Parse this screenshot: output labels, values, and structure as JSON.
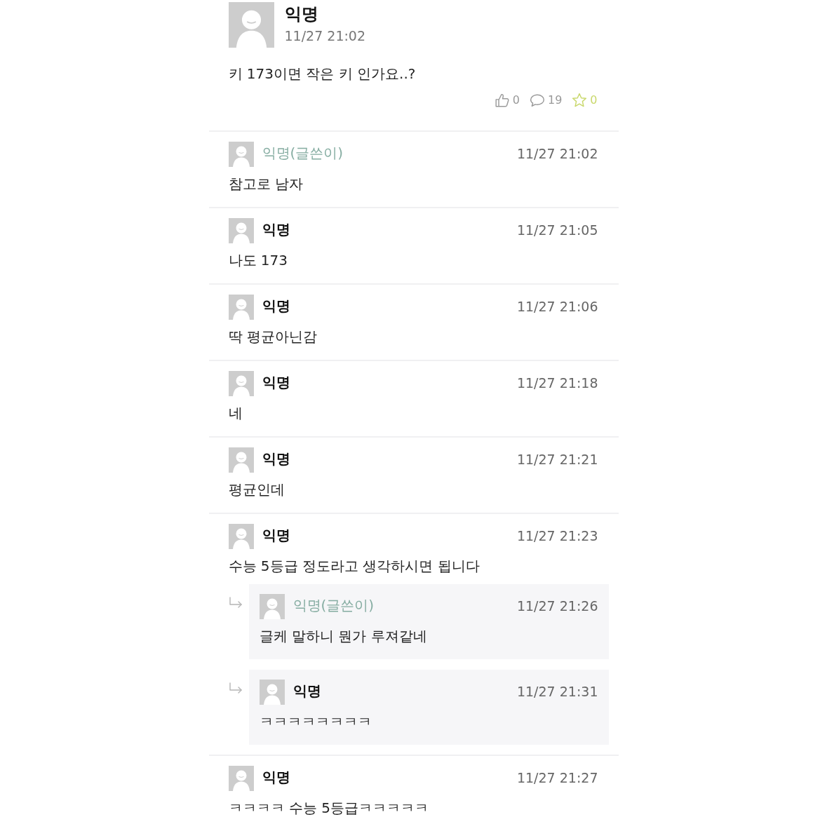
{
  "post": {
    "author": "익명",
    "time": "11/27 21:02",
    "body": "키 173이면 작은 키 인가요..?",
    "stats": [
      {
        "kind": "like",
        "count": "0"
      },
      {
        "kind": "comment",
        "count": "19"
      },
      {
        "kind": "scrap",
        "count": "0"
      }
    ]
  },
  "comments": [
    {
      "author": "익명(글쓴이)",
      "is_writer": true,
      "time": "11/27 21:02",
      "body": "참고로 남자"
    },
    {
      "author": "익명",
      "is_writer": false,
      "time": "11/27 21:05",
      "body": "나도 173"
    },
    {
      "author": "익명",
      "is_writer": false,
      "time": "11/27 21:06",
      "body": "딱 평균아닌감"
    },
    {
      "author": "익명",
      "is_writer": false,
      "time": "11/27 21:18",
      "body": "네"
    },
    {
      "author": "익명",
      "is_writer": false,
      "time": "11/27 21:21",
      "body": "평균인데"
    },
    {
      "author": "익명",
      "is_writer": false,
      "time": "11/27 21:23",
      "body": "수능 5등급 정도라고 생각하시면 됩니다",
      "children": [
        {
          "author": "익명(글쓴이)",
          "is_writer": true,
          "time": "11/27 21:26",
          "body": "글케 말하니 뭔가 루져같네"
        },
        {
          "author": "익명",
          "is_writer": false,
          "time": "11/27 21:31",
          "body": "ㅋㅋㅋㅋㅋㅋㅋㅋ"
        }
      ]
    },
    {
      "author": "익명",
      "is_writer": false,
      "time": "11/27 21:27",
      "body": "ㅋㅋㅋㅋ 수능 5등급ㅋㅋㅋㅋㅋ"
    }
  ]
}
